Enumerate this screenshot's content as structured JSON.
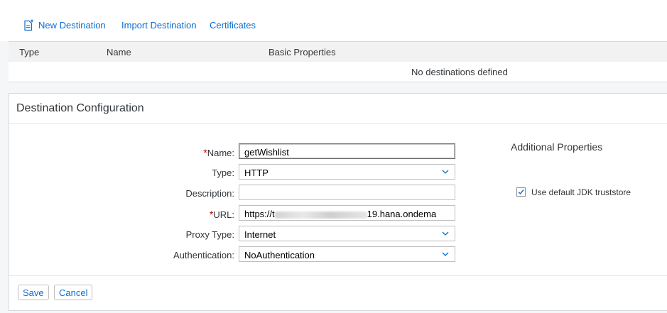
{
  "toolbar": {
    "new_destination": "New Destination",
    "import_destination": "Import Destination",
    "certificates": "Certificates"
  },
  "table": {
    "columns": [
      "Type",
      "Name",
      "Basic Properties"
    ],
    "empty_message": "No destinations defined"
  },
  "config": {
    "title": "Destination Configuration",
    "fields": {
      "name": {
        "label": "Name:",
        "value": "getWishlist",
        "required": true
      },
      "type": {
        "label": "Type:",
        "value": "HTTP"
      },
      "description": {
        "label": "Description:",
        "value": ""
      },
      "url": {
        "label": "URL:",
        "prefix": "https://t",
        "suffix": "19.hana.ondema",
        "required": true
      },
      "proxy_type": {
        "label": "Proxy Type:",
        "value": "Internet"
      },
      "authentication": {
        "label": "Authentication:",
        "value": "NoAuthentication"
      }
    },
    "additional_properties": {
      "title": "Additional Properties",
      "checkbox_label": "Use default JDK truststore",
      "checkbox_checked": true
    },
    "buttons": {
      "save": "Save",
      "cancel": "Cancel"
    }
  },
  "colors": {
    "accent": "#0a6ed1",
    "required": "#bb0000"
  },
  "icons": {
    "new_destination": "new-document-icon",
    "dropdown": "chevron-down-icon",
    "check": "checkmark-icon"
  }
}
